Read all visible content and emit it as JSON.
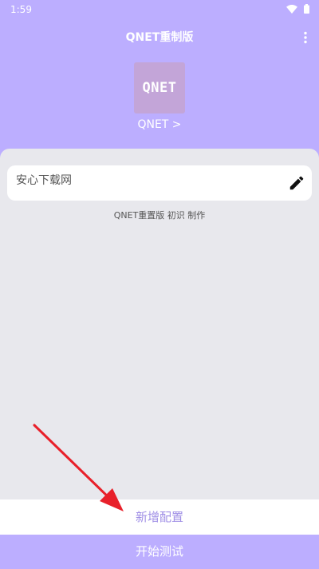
{
  "status_bar": {
    "time": "1:59",
    "icons": [
      "wifi-icon",
      "battery-icon"
    ]
  },
  "app_bar": {
    "title": "QNET重制版",
    "menu_icon": "more-vert-icon"
  },
  "logo": {
    "text": "QNET",
    "link_label": "QNET >"
  },
  "config": {
    "name": "安心下载网",
    "edit_icon": "pencil-icon"
  },
  "credits": "QNET重置版 初识 制作",
  "actions": {
    "add_config": "新增配置",
    "start_test": "开始测试"
  },
  "colors": {
    "accent": "#bcaeff",
    "panel": "#e8e8ed",
    "link_text": "#a08fe6",
    "annotation_arrow": "#e8202a"
  }
}
